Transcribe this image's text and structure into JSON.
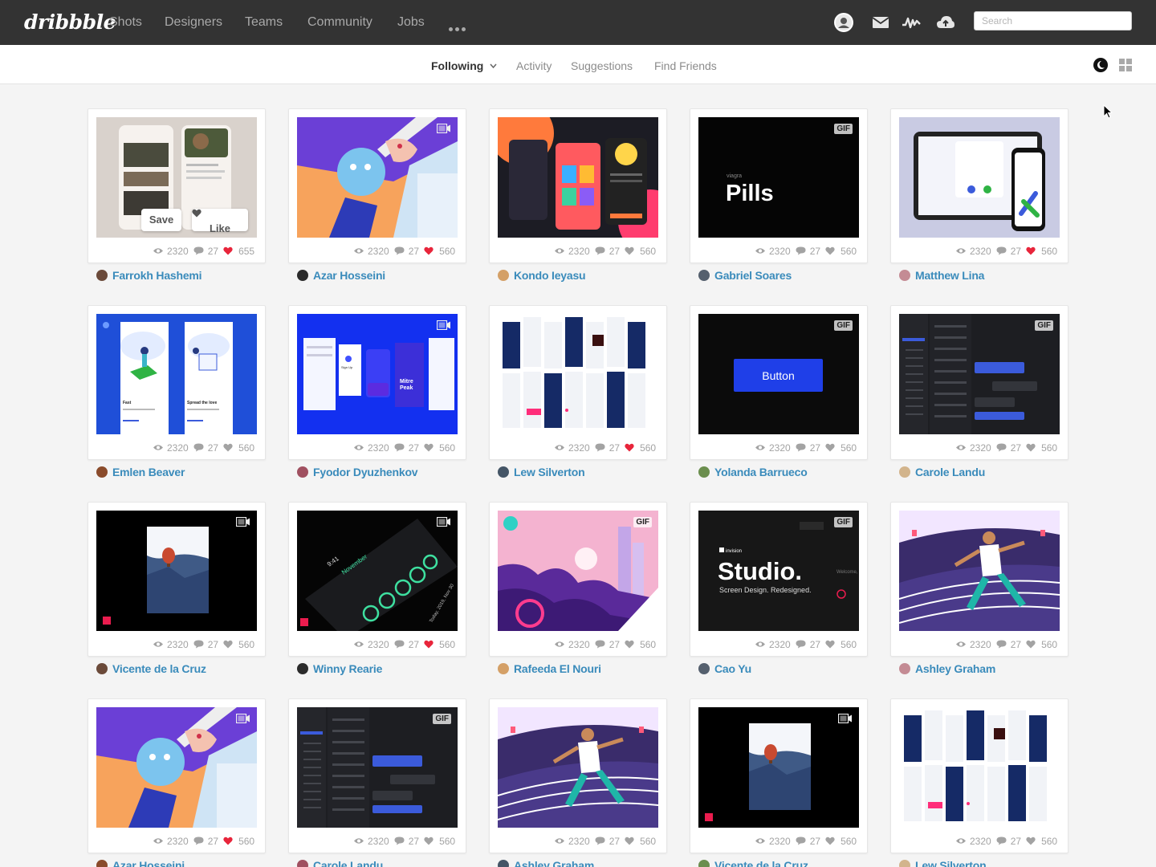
{
  "brand": {
    "logo": "dribbble",
    "accent": "#ea4c89",
    "link_color": "#3a8bbb"
  },
  "nav": {
    "links": [
      "Shots",
      "Designers",
      "Teams",
      "Community",
      "Jobs"
    ],
    "more_icon": "more-dots-icon",
    "icons": [
      "avatar-icon",
      "mail-icon",
      "activity-icon",
      "upload-cloud-icon"
    ],
    "search_placeholder": "Search"
  },
  "subnav": {
    "tabs": [
      "Following",
      "Activity",
      "Suggestions",
      "Find Friends"
    ],
    "active": "Following",
    "right_icons": [
      "theme-moon-icon",
      "grid-view-icon"
    ]
  },
  "hover_actions": {
    "save": "Save",
    "like": "Like"
  },
  "shots": [
    {
      "author": "Farrokh Hashemi",
      "views": "2320",
      "comments": "27",
      "likes": "655",
      "liked": true,
      "badge": "",
      "thumb": "events-app"
    },
    {
      "author": "Azar Hosseini",
      "views": "2320",
      "comments": "27",
      "likes": "560",
      "liked": true,
      "badge": "video",
      "thumb": "stylus-illustration"
    },
    {
      "author": "Kondo Ieyasu",
      "views": "2320",
      "comments": "27",
      "likes": "560",
      "liked": false,
      "badge": "",
      "thumb": "colorful-app"
    },
    {
      "author": "Gabriel Soares",
      "views": "2320",
      "comments": "27",
      "likes": "560",
      "liked": false,
      "badge": "GIF",
      "thumb": "pills",
      "label": "Pills",
      "sublabel": "viagra"
    },
    {
      "author": "Matthew Lina",
      "views": "2320",
      "comments": "27",
      "likes": "560",
      "liked": true,
      "badge": "",
      "thumb": "devices"
    },
    {
      "author": "Emlen Beaver",
      "views": "2320",
      "comments": "27",
      "likes": "560",
      "liked": false,
      "badge": "",
      "thumb": "onboarding",
      "captions": [
        "Fast",
        "Spread the love"
      ]
    },
    {
      "author": "Fyodor Dyuzhenkov",
      "views": "2320",
      "comments": "27",
      "likes": "560",
      "liked": false,
      "badge": "video",
      "thumb": "mitre-peak",
      "captions": [
        "Sign Up",
        "Mitre Peak"
      ]
    },
    {
      "author": "Lew Silverton",
      "views": "2320",
      "comments": "27",
      "likes": "560",
      "liked": true,
      "badge": "",
      "thumb": "wireframes"
    },
    {
      "author": "Yolanda Barrueco",
      "views": "2320",
      "comments": "27",
      "likes": "560",
      "liked": false,
      "badge": "GIF",
      "thumb": "button",
      "label": "Button"
    },
    {
      "author": "Carole Landu",
      "views": "2320",
      "comments": "27",
      "likes": "560",
      "liked": false,
      "badge": "GIF",
      "thumb": "chat-dark"
    },
    {
      "author": "Vicente de la Cruz",
      "views": "2320",
      "comments": "27",
      "likes": "560",
      "liked": false,
      "badge": "video",
      "thumb": "balloon"
    },
    {
      "author": "Winny Rearie",
      "views": "2320",
      "comments": "27",
      "likes": "560",
      "liked": true,
      "badge": "video",
      "thumb": "dark-phone",
      "captions": [
        "9:41",
        "November",
        "Today, 2019, Nov 30"
      ]
    },
    {
      "author": "Rafeeda El Nouri",
      "views": "2320",
      "comments": "27",
      "likes": "560",
      "liked": false,
      "badge": "GIF",
      "thumb": "crowd"
    },
    {
      "author": "Cao Yu",
      "views": "2320",
      "comments": "27",
      "likes": "560",
      "liked": false,
      "badge": "GIF",
      "thumb": "studio",
      "label": "Studio.",
      "sublabel": "Screen Design. Redesigned.",
      "brand": "invision",
      "side": "Welcome, David."
    },
    {
      "author": "Ashley Graham",
      "views": "2320",
      "comments": "27",
      "likes": "560",
      "liked": false,
      "badge": "",
      "thumb": "runner"
    },
    {
      "author": "Azar Hosseini",
      "views": "2320",
      "comments": "27",
      "likes": "560",
      "liked": true,
      "badge": "video",
      "thumb": "stylus-illustration"
    },
    {
      "author": "Carole Landu",
      "views": "2320",
      "comments": "27",
      "likes": "560",
      "liked": false,
      "badge": "GIF",
      "thumb": "chat-dark"
    },
    {
      "author": "Ashley Graham",
      "views": "2320",
      "comments": "27",
      "likes": "560",
      "liked": false,
      "badge": "",
      "thumb": "runner"
    },
    {
      "author": "Vicente de la Cruz",
      "views": "2320",
      "comments": "27",
      "likes": "560",
      "liked": false,
      "badge": "video",
      "thumb": "balloon"
    },
    {
      "author": "Lew Silverton",
      "views": "2320",
      "comments": "27",
      "likes": "560",
      "liked": false,
      "badge": "",
      "thumb": "wireframes"
    }
  ]
}
